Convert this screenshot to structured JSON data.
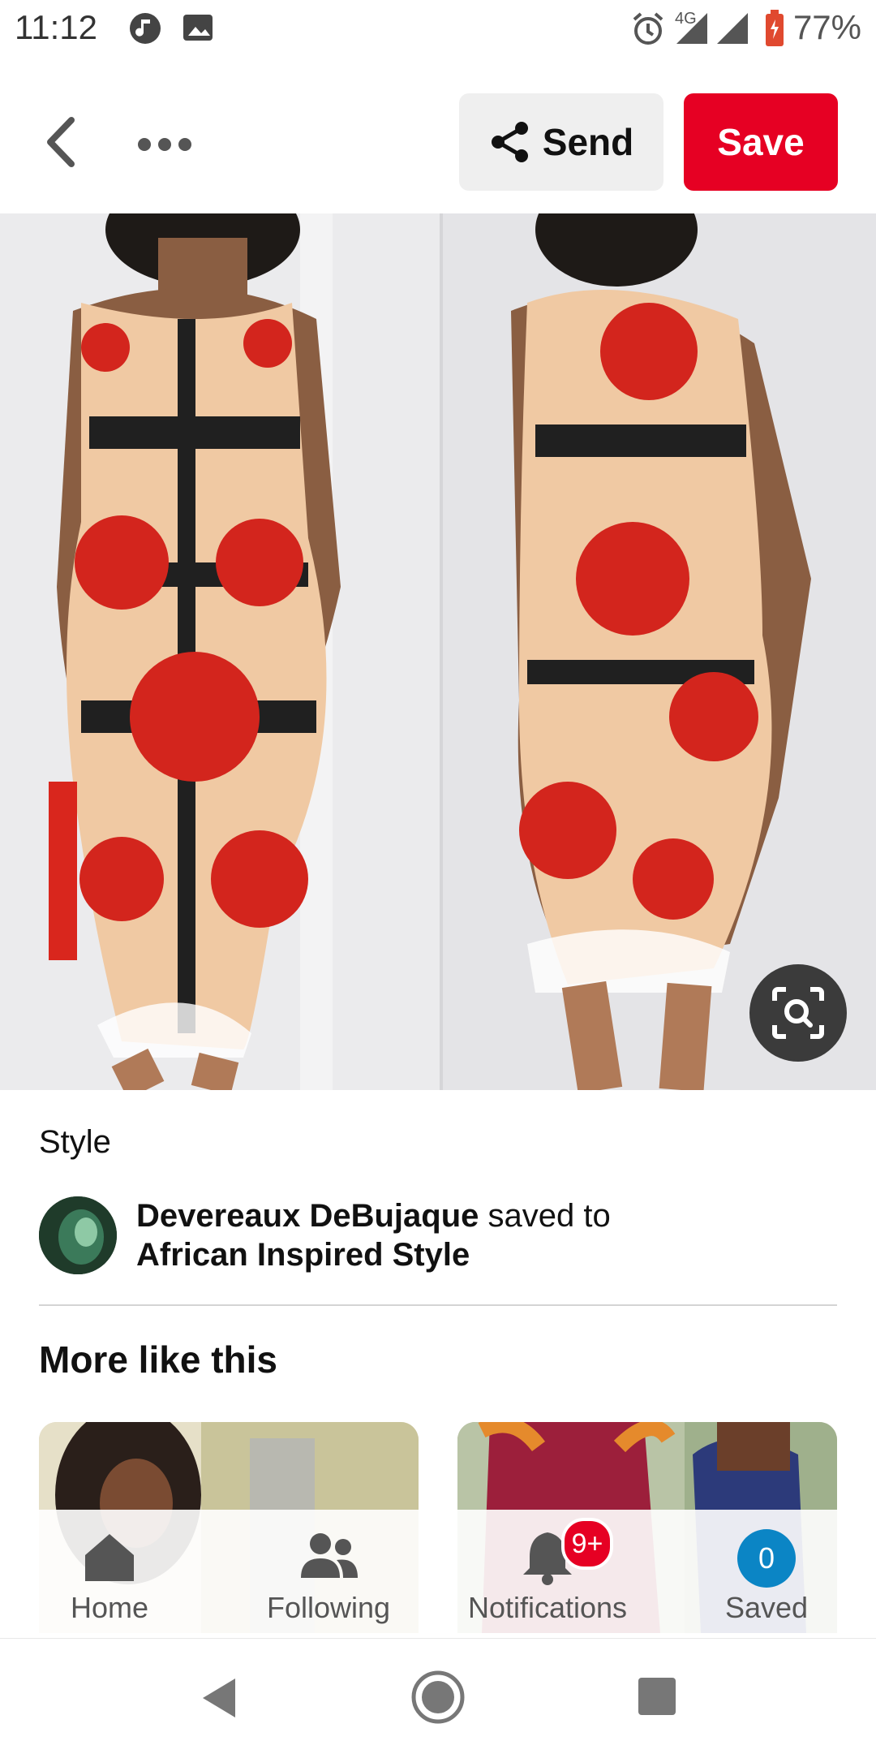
{
  "status_bar": {
    "time": "11:12",
    "network": "4G",
    "battery": "77%",
    "icons": [
      "music-icon",
      "image-icon",
      "alarm-icon",
      "signal-icon",
      "signal-icon",
      "battery-icon"
    ]
  },
  "header": {
    "send_label": "Send",
    "save_label": "Save",
    "save_color": "#e60023"
  },
  "pin": {
    "title": "Style",
    "saver_name": "Devereaux DeBujaque",
    "saved_to_text": "saved to",
    "board_name": "African Inspired Style"
  },
  "more_like_this": {
    "heading": "More like this"
  },
  "bottom_nav": {
    "items": [
      {
        "label": "Home",
        "icon": "home-icon"
      },
      {
        "label": "Following",
        "icon": "people-icon"
      },
      {
        "label": "Notifications",
        "icon": "bell-icon",
        "badge": "9+"
      },
      {
        "label": "Saved",
        "icon": "profile-initial",
        "initial": "0"
      }
    ]
  },
  "system_nav": {
    "icons": [
      "back-icon",
      "home-icon",
      "recent-apps-icon"
    ]
  }
}
